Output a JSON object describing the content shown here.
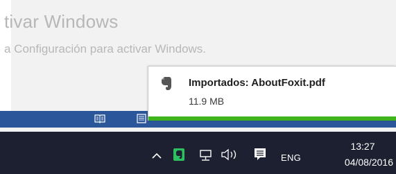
{
  "watermark": {
    "title": "tivar Windows",
    "subtitle": "a Configuración para activar Windows."
  },
  "statusbar": {
    "color": "#2b579a",
    "icons": [
      "read-mode-icon",
      "print-layout-icon"
    ]
  },
  "notification": {
    "app_icon": "evernote-icon",
    "title": "Importados: AboutFoxit.pdf",
    "detail": "11.9 MB",
    "progress": 1.0,
    "progress_color": "#3fb31c"
  },
  "taskbar": {
    "background": "#1c2030",
    "tray": {
      "icons": [
        "chevron-up-icon",
        "evernote-icon",
        "network-icon",
        "volume-icon",
        "action-center-icon"
      ],
      "language": "ENG",
      "time": "13:27",
      "date": "04/08/2016"
    }
  }
}
